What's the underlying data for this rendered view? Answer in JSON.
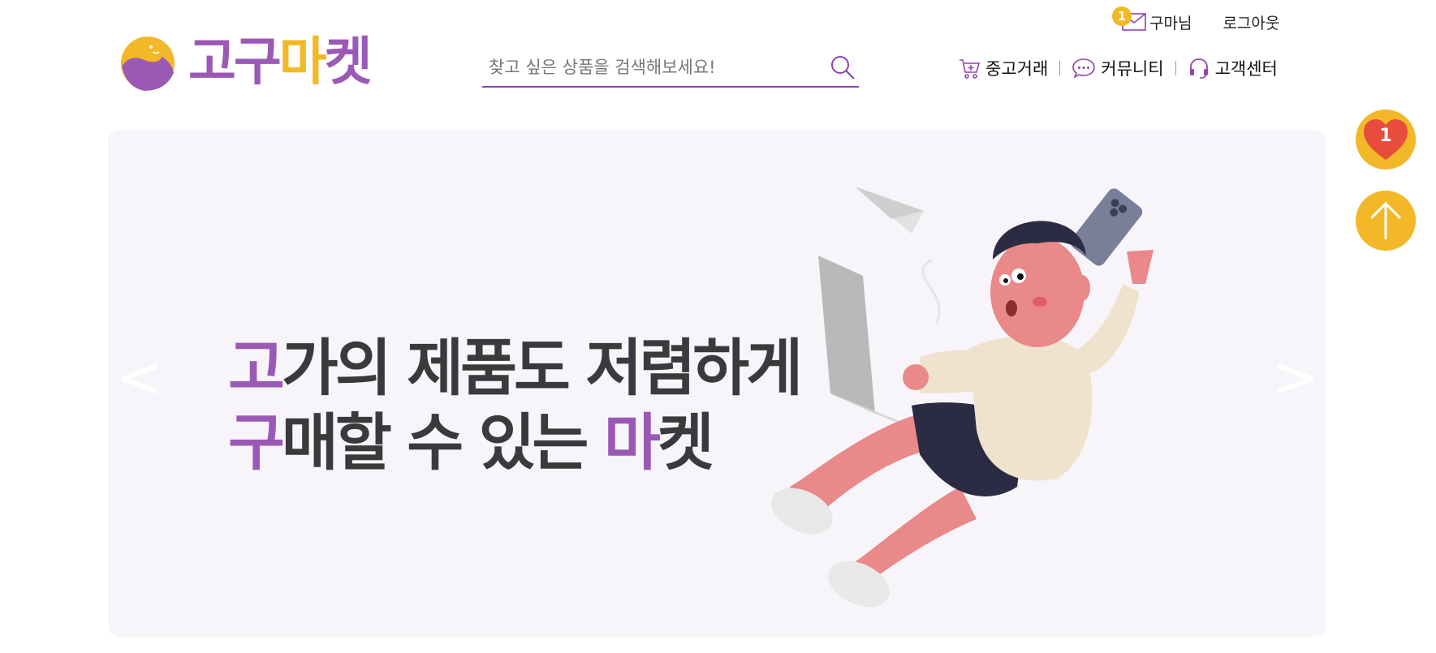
{
  "topbar": {
    "mail_badge": "1",
    "username": "구마님",
    "logout": "로그아웃"
  },
  "logo": {
    "part1": "고구",
    "part2": "마",
    "part3": "켓"
  },
  "search": {
    "placeholder": "찾고 싶은 상품을 검색해보세요!",
    "value": ""
  },
  "nav": {
    "items": [
      {
        "label": "중고거래",
        "icon": "cart-icon"
      },
      {
        "label": "커뮤니티",
        "icon": "chat-bubble-icon"
      },
      {
        "label": "고객센터",
        "icon": "headset-icon"
      }
    ]
  },
  "floating": {
    "wishlist_count": "1",
    "wishlist_icon": "heart-icon",
    "top_icon": "arrow-up-icon"
  },
  "banner": {
    "line1_highlight": "고",
    "line1_rest": "가의 제품도 저렴하게",
    "line2_highlight": "구",
    "line2_mid": "매할 수 있는 ",
    "line2_highlight2": "마",
    "line2_rest": "켓",
    "prev": "<",
    "next": ">"
  },
  "colors": {
    "brand_purple": "#9b59b6",
    "brand_yellow": "#f2b827",
    "banner_bg": "#f8f5fa",
    "heart_red": "#e74c3c"
  }
}
